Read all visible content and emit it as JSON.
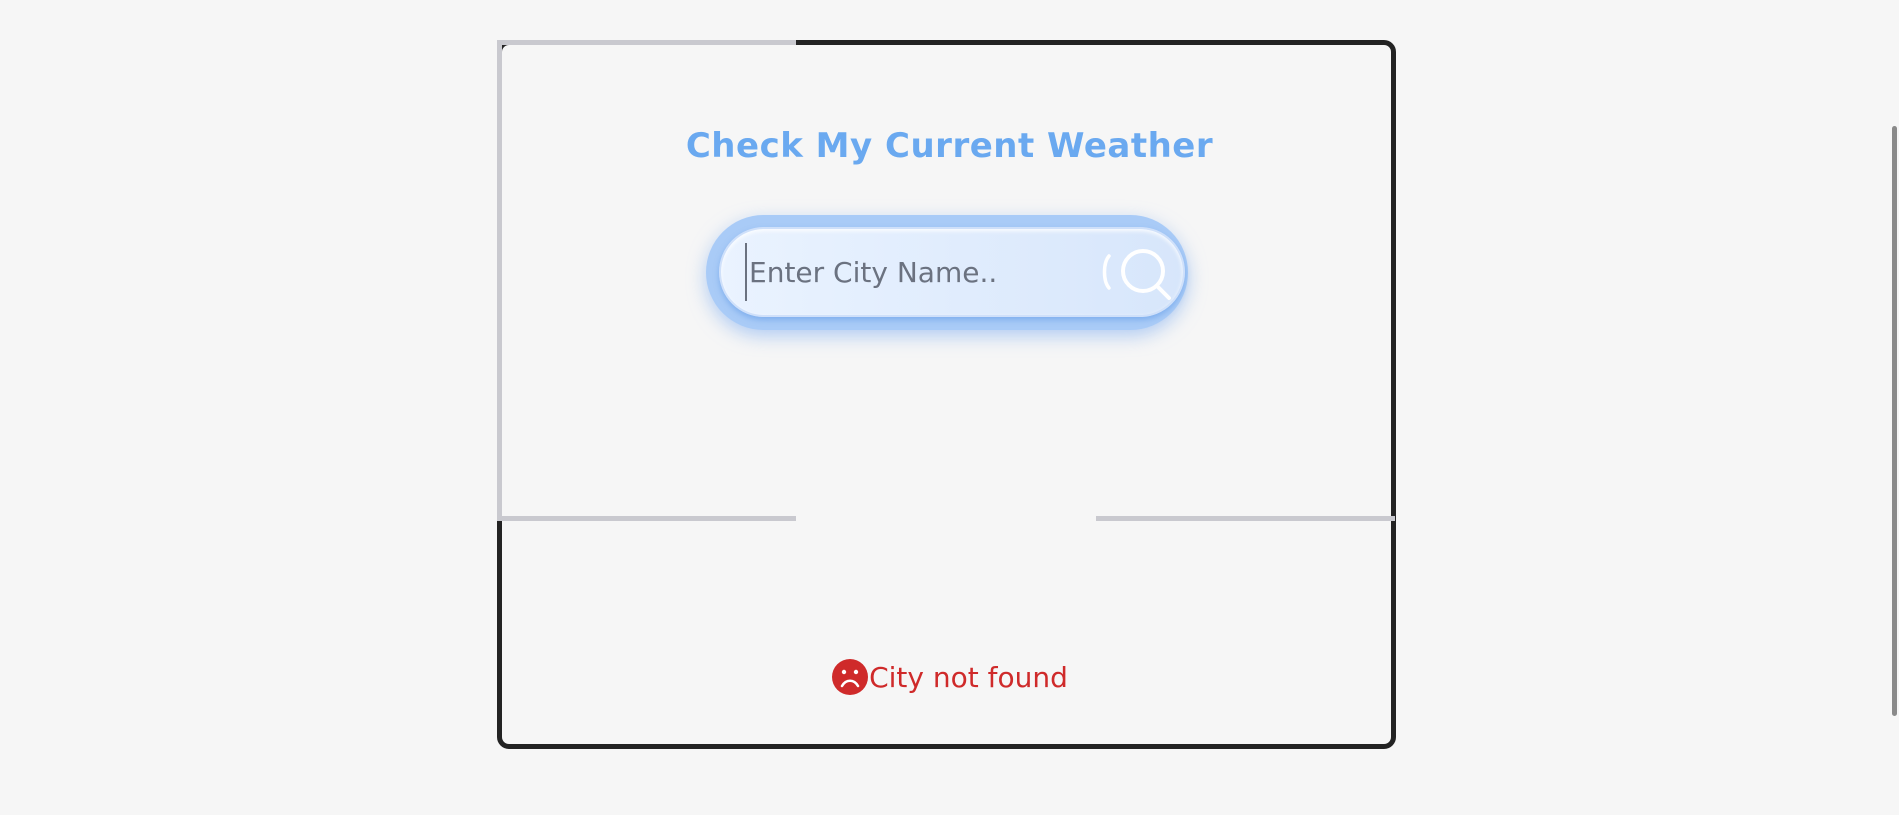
{
  "app": {
    "title": "Check My Current Weather"
  },
  "search": {
    "placeholder": "Enter City Name..",
    "value": "",
    "button_icon": "search-icon",
    "accent_color": "#6aa9f0"
  },
  "status": {
    "message": "City not found",
    "icon": "sad-face-icon",
    "color": "#cf2a2a"
  }
}
